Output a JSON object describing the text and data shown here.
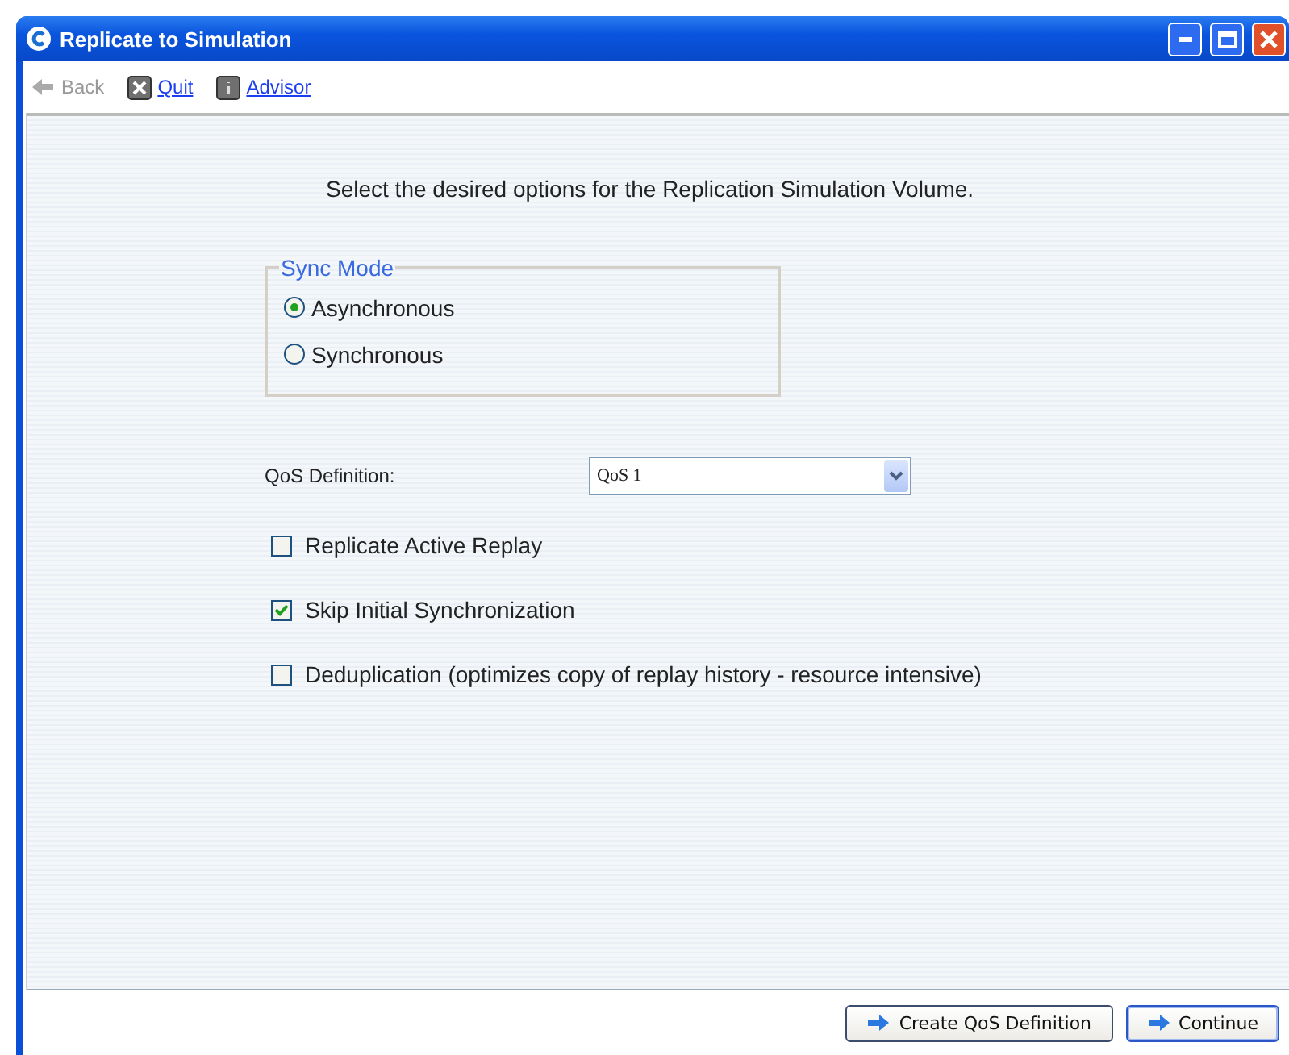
{
  "window": {
    "title": "Replicate to Simulation"
  },
  "toolbar": [
    {
      "kind": "back",
      "label": "Back",
      "disabled": true
    },
    {
      "kind": "quit",
      "label": "Quit",
      "disabled": false
    },
    {
      "kind": "advisor",
      "label": "Advisor",
      "disabled": false
    }
  ],
  "instruction": "Select the desired options for the Replication Simulation Volume.",
  "sync_mode": {
    "legend": "Sync Mode",
    "options": [
      {
        "label": "Asynchronous",
        "selected": true
      },
      {
        "label": "Synchronous",
        "selected": false
      }
    ]
  },
  "qos": {
    "label": "QoS Definition:",
    "value": "QoS 1"
  },
  "options": [
    {
      "label": "Replicate Active Replay",
      "checked": false
    },
    {
      "label": "Skip Initial Synchronization",
      "checked": true
    },
    {
      "label": "Deduplication (optimizes copy of replay history - resource intensive)",
      "checked": false
    }
  ],
  "buttons": [
    {
      "label": "Create QoS Definition",
      "default": false
    },
    {
      "label": "Continue",
      "default": true
    }
  ]
}
